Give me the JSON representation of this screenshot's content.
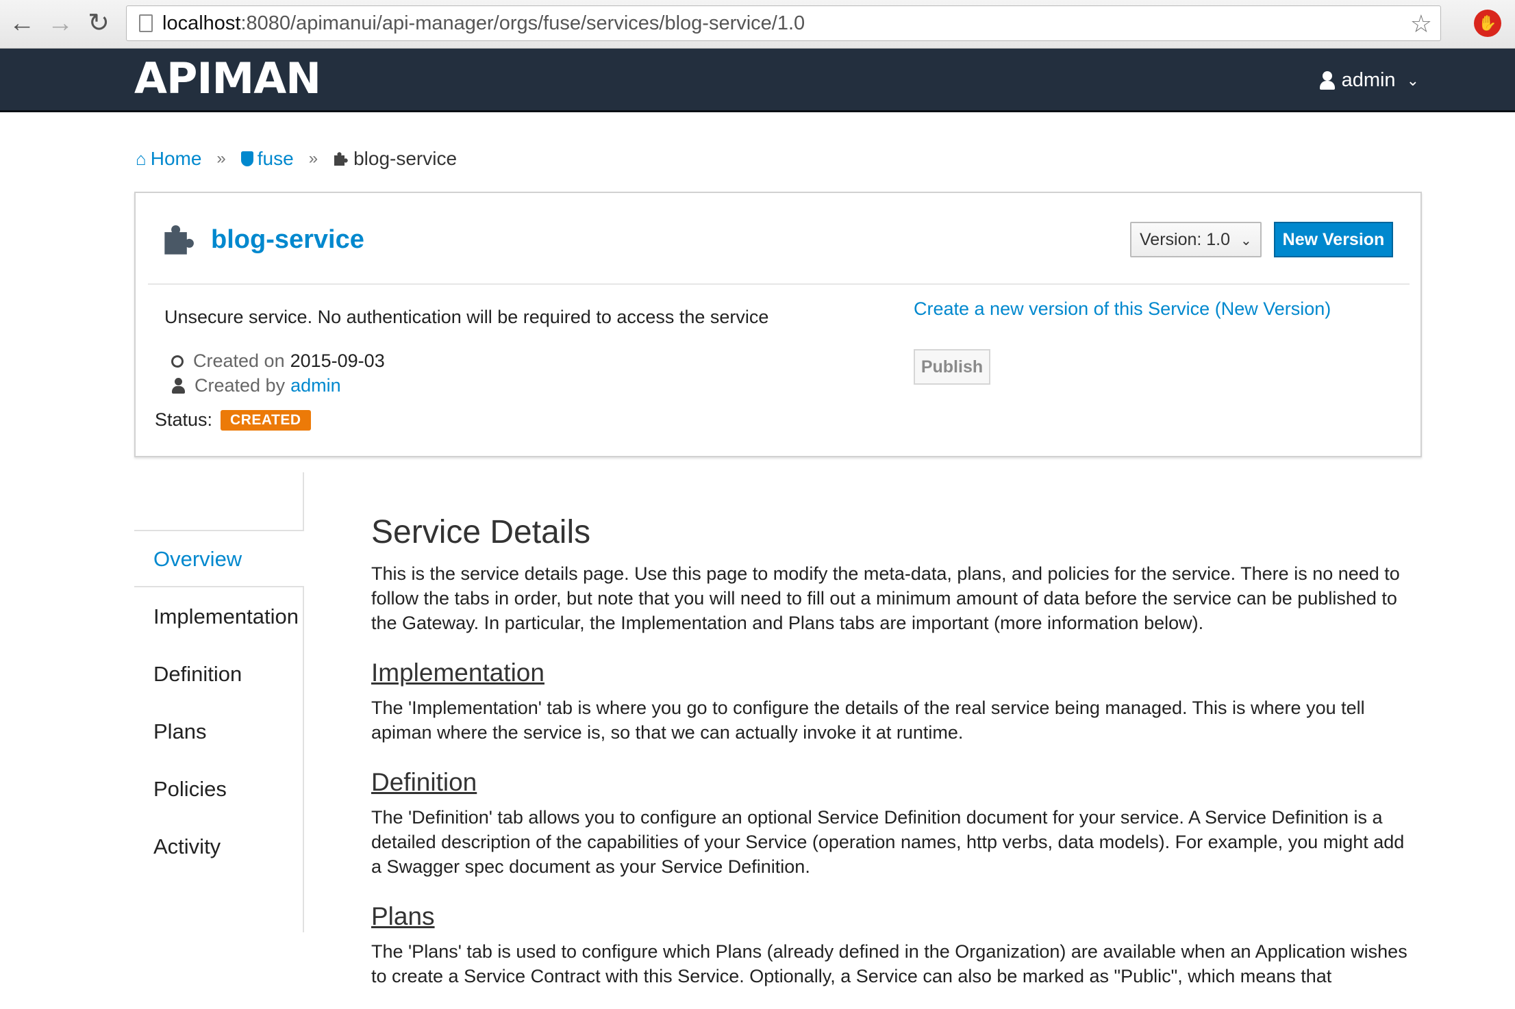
{
  "browser": {
    "url_host": "localhost",
    "url_rest": ":8080/apimanui/api-manager/orgs/fuse/services/blog-service/1.0"
  },
  "header": {
    "logo": "APIMAN",
    "user": "admin"
  },
  "breadcrumb": {
    "home": "Home",
    "org": "fuse",
    "current": "blog-service"
  },
  "service": {
    "name": "blog-service",
    "version_label": "Version: 1.0",
    "new_version_label": "New Version",
    "description": "Unsecure service. No authentication will be required to access the service",
    "created_on_label": "Created on",
    "created_on": "2015-09-03",
    "created_by_label": "Created by",
    "created_by": "admin",
    "status_label": "Status:",
    "status": "CREATED",
    "create_version_link": "Create a new version of this Service (New Version)",
    "publish_label": "Publish"
  },
  "tabs": [
    {
      "label": "Overview"
    },
    {
      "label": "Implementation"
    },
    {
      "label": "Definition"
    },
    {
      "label": "Plans"
    },
    {
      "label": "Policies"
    },
    {
      "label": "Activity"
    }
  ],
  "content": {
    "title": "Service Details",
    "intro": "This is the service details page. Use this page to modify the meta-data, plans, and policies for the service. There is no need to follow the tabs in order, but note that you will need to fill out a minimum amount of data before the service can be published to the Gateway. In particular, the Implementation and Plans tabs are important (more information below).",
    "sections": [
      {
        "heading": "Implementation",
        "text": "The 'Implementation' tab is where you go to configure the details of the real service being managed. This is where you tell apiman where the service is, so that we can actually invoke it at runtime."
      },
      {
        "heading": "Definition",
        "text": "The 'Definition' tab allows you to configure an optional Service Definition document for your service. A Service Definition is a detailed description of the capabilities of your Service (operation names, http verbs, data models). For example, you might add a Swagger spec document as your Service Definition."
      },
      {
        "heading": "Plans",
        "text": "The 'Plans' tab is used to configure which Plans (already defined in the Organization) are available when an Application wishes to create a Service Contract with this Service. Optionally, a Service can also be marked as \"Public\", which means that"
      }
    ]
  },
  "colors": {
    "brand_blue": "#0088ce",
    "header_bg": "#232f3e",
    "status_orange": "#ec7a08"
  }
}
